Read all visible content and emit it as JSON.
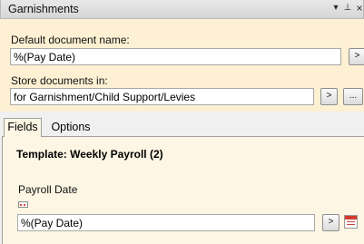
{
  "panel": {
    "title": "Garnishments",
    "controls": {
      "dropdown": "▾",
      "pin": "⊥",
      "close": "×"
    }
  },
  "default_doc": {
    "label": "Default document name:",
    "value": "%(Pay Date)",
    "button": ">"
  },
  "store_docs": {
    "label": "Store documents in:",
    "value": "for Garnishment/Child Support/Levies",
    "button": ">",
    "browse": "..."
  },
  "tabs": [
    {
      "label": "Fields",
      "active": true
    },
    {
      "label": "Options",
      "active": false
    }
  ],
  "fields_tab": {
    "template_title": "Template: Weekly Payroll (2)",
    "field_label": "Payroll Date",
    "field_value": "%(Pay Date)",
    "button": ">"
  },
  "icons": {
    "field_type": "date-field-icon",
    "calendar": "calendar-icon"
  },
  "colors": {
    "top_section_bg": "#fdf0d3",
    "tab_content_bg": "#fdf6e4"
  }
}
